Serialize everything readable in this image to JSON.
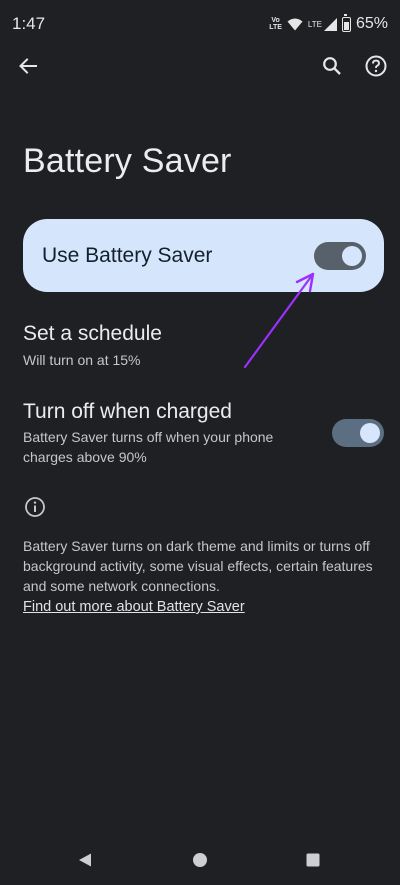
{
  "status_bar": {
    "time": "1:47",
    "volte_top": "Vo",
    "volte_bottom": "LTE",
    "lte_label": "LTE",
    "battery_percent": "65%"
  },
  "app_bar": {
    "icons": [
      "back-arrow-icon",
      "search-icon",
      "help-icon"
    ]
  },
  "page": {
    "title": "Battery Saver"
  },
  "main_toggle": {
    "label": "Use Battery Saver",
    "state": "on"
  },
  "schedule": {
    "title": "Set a schedule",
    "subtitle": "Will turn on at 15%"
  },
  "turn_off_when_charged": {
    "title": "Turn off when charged",
    "subtitle": "Battery Saver turns off when your phone charges above 90%",
    "state": "on"
  },
  "info": {
    "text": "Battery Saver turns on dark theme and limits or turns off background activity, some visual effects, certain features and some network connections.",
    "link": "Find out more about Battery Saver"
  },
  "annotation": {
    "color": "#9b30ff"
  },
  "nav_bar": {
    "icons": [
      "back-triangle-icon",
      "home-circle-icon",
      "recents-square-icon"
    ]
  }
}
